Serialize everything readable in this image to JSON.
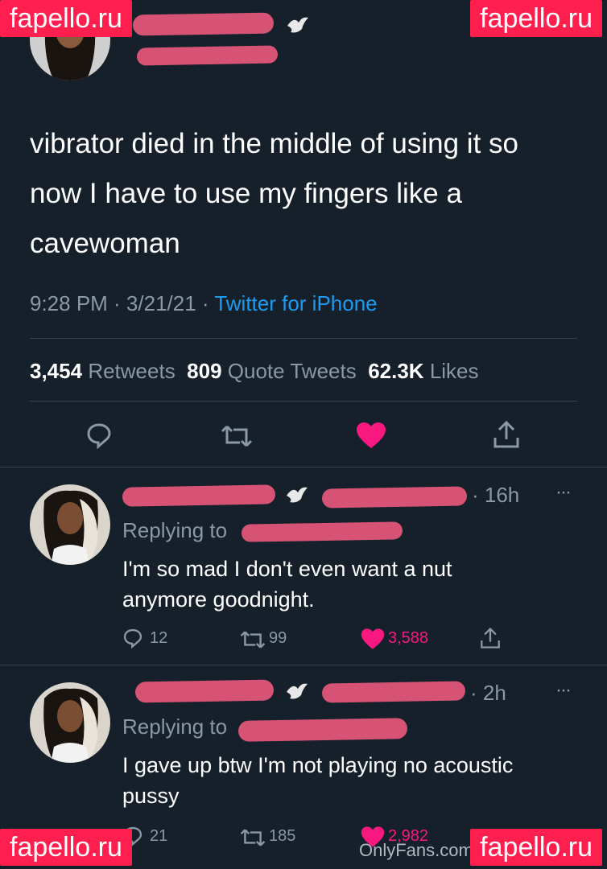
{
  "watermarks": {
    "top_left": "fapello.ru",
    "top_right": "fapello.ru",
    "bottom_left": "fapello.ru",
    "bottom_right": "fapello.ru",
    "footer": "OnlyFans.com"
  },
  "tweet": {
    "text": "vibrator died in the middle of using it so now I have to use my fingers like a cavewoman",
    "time": "9:28 PM · 3/21/21 · ",
    "source": "Twitter for iPhone",
    "stats": {
      "retweets_count": "3,454",
      "retweets_label": "Retweets",
      "quotes_count": "809",
      "quotes_label": "Quote Tweets",
      "likes_count": "62.3K",
      "likes_label": "Likes"
    }
  },
  "replies": [
    {
      "time": "· 16h",
      "replying_to": "Replying to",
      "text": "I'm so mad I don't even want a nut anymore goodnight.",
      "reply_count": "12",
      "retweet_count": "99",
      "like_count": "3,588"
    },
    {
      "time": "· 2h",
      "replying_to": "Replying to",
      "text": "I gave up btw I'm not playing no acoustic pussy",
      "reply_count": "21",
      "retweet_count": "185",
      "like_count": "2,982"
    }
  ],
  "more_label": "···",
  "icons": [
    "reply-icon",
    "retweet-icon",
    "heart-icon",
    "share-icon",
    "dove-icon",
    "more-icon"
  ],
  "colors": {
    "background": "#15202b",
    "accent": "#1d9bf0",
    "like": "#f91880",
    "redaction": "#e0567a"
  }
}
